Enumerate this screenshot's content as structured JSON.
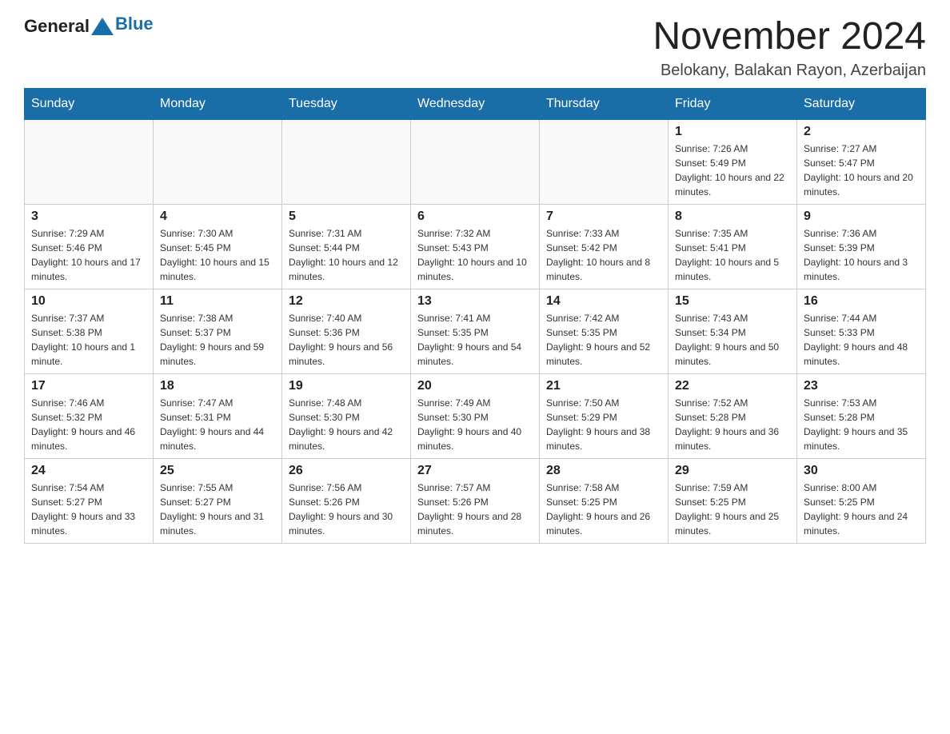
{
  "header": {
    "logo_general": "General",
    "logo_blue": "Blue",
    "month_year": "November 2024",
    "location": "Belokany, Balakan Rayon, Azerbaijan"
  },
  "days_of_week": [
    "Sunday",
    "Monday",
    "Tuesday",
    "Wednesday",
    "Thursday",
    "Friday",
    "Saturday"
  ],
  "weeks": [
    [
      {
        "day": "",
        "info": ""
      },
      {
        "day": "",
        "info": ""
      },
      {
        "day": "",
        "info": ""
      },
      {
        "day": "",
        "info": ""
      },
      {
        "day": "",
        "info": ""
      },
      {
        "day": "1",
        "info": "Sunrise: 7:26 AM\nSunset: 5:49 PM\nDaylight: 10 hours and 22 minutes."
      },
      {
        "day": "2",
        "info": "Sunrise: 7:27 AM\nSunset: 5:47 PM\nDaylight: 10 hours and 20 minutes."
      }
    ],
    [
      {
        "day": "3",
        "info": "Sunrise: 7:29 AM\nSunset: 5:46 PM\nDaylight: 10 hours and 17 minutes."
      },
      {
        "day": "4",
        "info": "Sunrise: 7:30 AM\nSunset: 5:45 PM\nDaylight: 10 hours and 15 minutes."
      },
      {
        "day": "5",
        "info": "Sunrise: 7:31 AM\nSunset: 5:44 PM\nDaylight: 10 hours and 12 minutes."
      },
      {
        "day": "6",
        "info": "Sunrise: 7:32 AM\nSunset: 5:43 PM\nDaylight: 10 hours and 10 minutes."
      },
      {
        "day": "7",
        "info": "Sunrise: 7:33 AM\nSunset: 5:42 PM\nDaylight: 10 hours and 8 minutes."
      },
      {
        "day": "8",
        "info": "Sunrise: 7:35 AM\nSunset: 5:41 PM\nDaylight: 10 hours and 5 minutes."
      },
      {
        "day": "9",
        "info": "Sunrise: 7:36 AM\nSunset: 5:39 PM\nDaylight: 10 hours and 3 minutes."
      }
    ],
    [
      {
        "day": "10",
        "info": "Sunrise: 7:37 AM\nSunset: 5:38 PM\nDaylight: 10 hours and 1 minute."
      },
      {
        "day": "11",
        "info": "Sunrise: 7:38 AM\nSunset: 5:37 PM\nDaylight: 9 hours and 59 minutes."
      },
      {
        "day": "12",
        "info": "Sunrise: 7:40 AM\nSunset: 5:36 PM\nDaylight: 9 hours and 56 minutes."
      },
      {
        "day": "13",
        "info": "Sunrise: 7:41 AM\nSunset: 5:35 PM\nDaylight: 9 hours and 54 minutes."
      },
      {
        "day": "14",
        "info": "Sunrise: 7:42 AM\nSunset: 5:35 PM\nDaylight: 9 hours and 52 minutes."
      },
      {
        "day": "15",
        "info": "Sunrise: 7:43 AM\nSunset: 5:34 PM\nDaylight: 9 hours and 50 minutes."
      },
      {
        "day": "16",
        "info": "Sunrise: 7:44 AM\nSunset: 5:33 PM\nDaylight: 9 hours and 48 minutes."
      }
    ],
    [
      {
        "day": "17",
        "info": "Sunrise: 7:46 AM\nSunset: 5:32 PM\nDaylight: 9 hours and 46 minutes."
      },
      {
        "day": "18",
        "info": "Sunrise: 7:47 AM\nSunset: 5:31 PM\nDaylight: 9 hours and 44 minutes."
      },
      {
        "day": "19",
        "info": "Sunrise: 7:48 AM\nSunset: 5:30 PM\nDaylight: 9 hours and 42 minutes."
      },
      {
        "day": "20",
        "info": "Sunrise: 7:49 AM\nSunset: 5:30 PM\nDaylight: 9 hours and 40 minutes."
      },
      {
        "day": "21",
        "info": "Sunrise: 7:50 AM\nSunset: 5:29 PM\nDaylight: 9 hours and 38 minutes."
      },
      {
        "day": "22",
        "info": "Sunrise: 7:52 AM\nSunset: 5:28 PM\nDaylight: 9 hours and 36 minutes."
      },
      {
        "day": "23",
        "info": "Sunrise: 7:53 AM\nSunset: 5:28 PM\nDaylight: 9 hours and 35 minutes."
      }
    ],
    [
      {
        "day": "24",
        "info": "Sunrise: 7:54 AM\nSunset: 5:27 PM\nDaylight: 9 hours and 33 minutes."
      },
      {
        "day": "25",
        "info": "Sunrise: 7:55 AM\nSunset: 5:27 PM\nDaylight: 9 hours and 31 minutes."
      },
      {
        "day": "26",
        "info": "Sunrise: 7:56 AM\nSunset: 5:26 PM\nDaylight: 9 hours and 30 minutes."
      },
      {
        "day": "27",
        "info": "Sunrise: 7:57 AM\nSunset: 5:26 PM\nDaylight: 9 hours and 28 minutes."
      },
      {
        "day": "28",
        "info": "Sunrise: 7:58 AM\nSunset: 5:25 PM\nDaylight: 9 hours and 26 minutes."
      },
      {
        "day": "29",
        "info": "Sunrise: 7:59 AM\nSunset: 5:25 PM\nDaylight: 9 hours and 25 minutes."
      },
      {
        "day": "30",
        "info": "Sunrise: 8:00 AM\nSunset: 5:25 PM\nDaylight: 9 hours and 24 minutes."
      }
    ]
  ]
}
